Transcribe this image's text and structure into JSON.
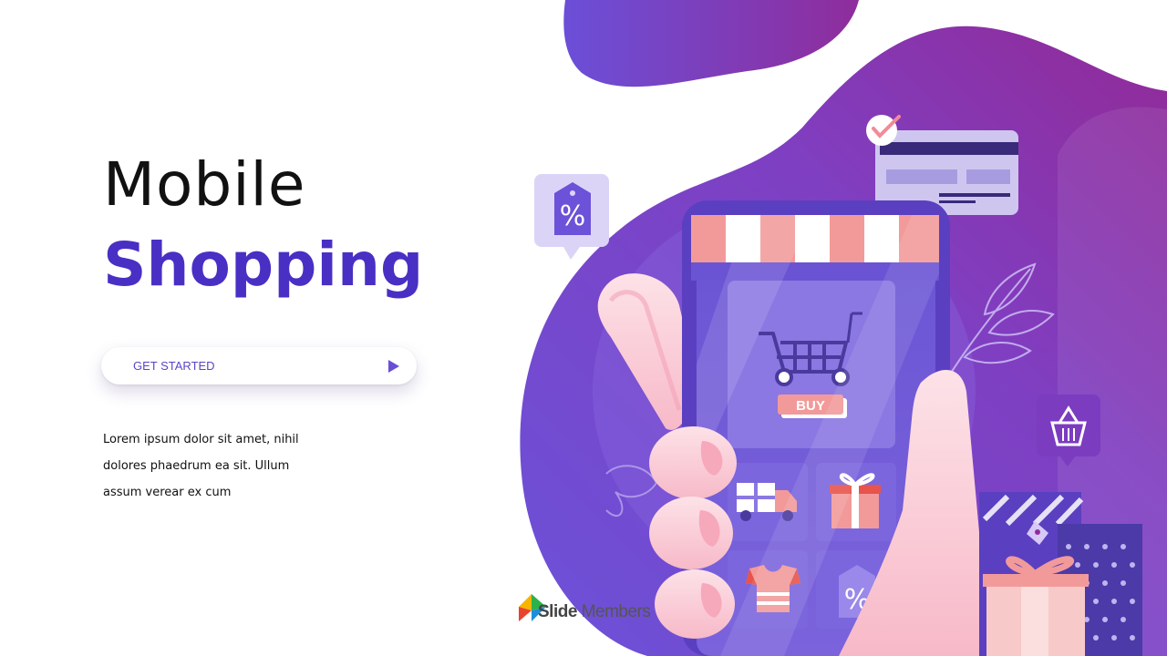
{
  "title": {
    "line1": "Mobile",
    "line2": "Shopping"
  },
  "cta": {
    "label": "GET STARTED",
    "icon": "play-arrow-icon"
  },
  "description": "Lorem ipsum dolor sit amet, nihil dolores phaedrum  ea sit. Ullum assum verear ex cum",
  "phone": {
    "button_label": "BUY"
  },
  "brand": {
    "name_bold": "Slide",
    "name_regular": "Members"
  },
  "colors": {
    "accent": "#4a2fc4",
    "purple_dark": "#6a3fcf",
    "magenta": "#8e2d9e",
    "pink": "#f29a9a"
  }
}
